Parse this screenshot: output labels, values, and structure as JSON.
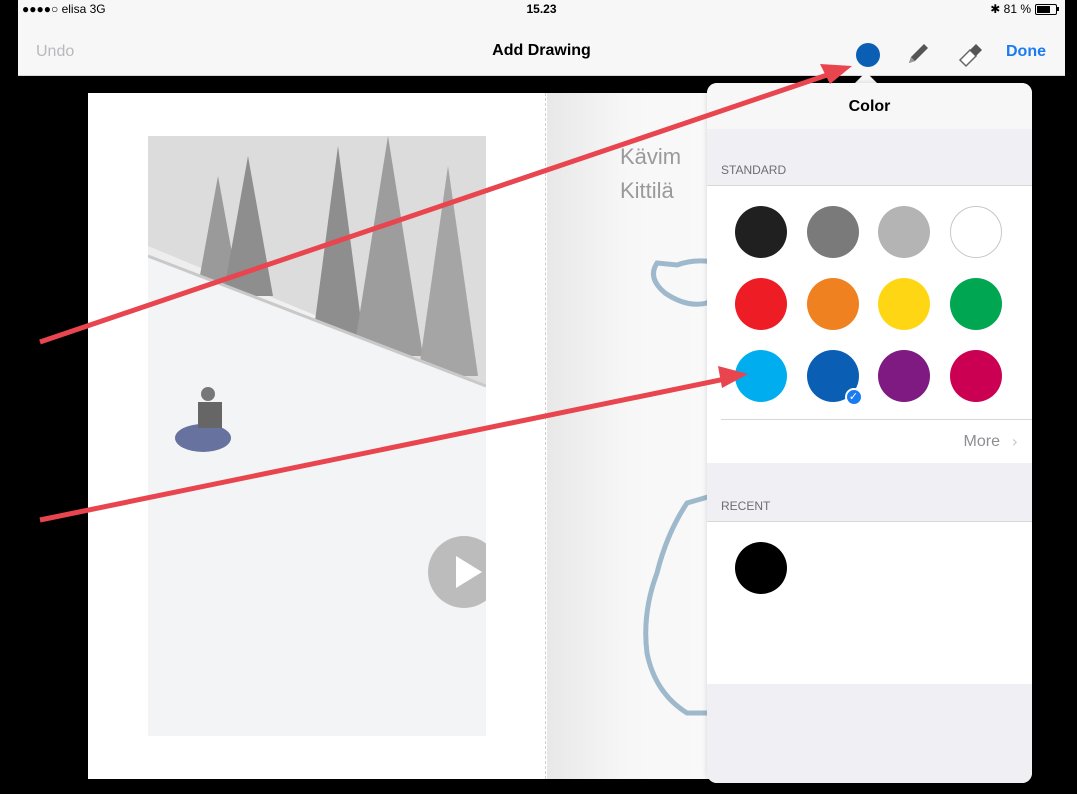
{
  "status_bar": {
    "carrier": "●●●●○ elisa  3G",
    "time": "15.23",
    "battery": "✱ 81 %",
    "battery_level": 0.81
  },
  "nav_bar": {
    "undo_label": "Undo",
    "title": "Add Drawing",
    "done_label": "Done",
    "current_color": "#0a5fb4",
    "tools": [
      "color-picker",
      "pencil-icon",
      "eraser-icon"
    ]
  },
  "page": {
    "text_lines": [
      "Kävim",
      "Kittilä"
    ],
    "media": "video-thumbnail",
    "play_icon": "play-icon"
  },
  "color_popover": {
    "title": "Color",
    "standard_label": "STANDARD",
    "standard_colors": [
      "#202020",
      "#7a7a7a",
      "#b4b4b4",
      "#ffffff",
      "#ee1c25",
      "#f08121",
      "#ffd614",
      "#00a651",
      "#00aeef",
      "#0a5fb4",
      "#7e1a82",
      "#cc0052"
    ],
    "selected_color": "#0a5fb4",
    "more_label": "More",
    "recent_label": "RECENT",
    "recent_colors": [
      "#000000"
    ]
  },
  "colors": {
    "accent": "#1b7cf2",
    "annotation_arrow": "#e8454f"
  }
}
